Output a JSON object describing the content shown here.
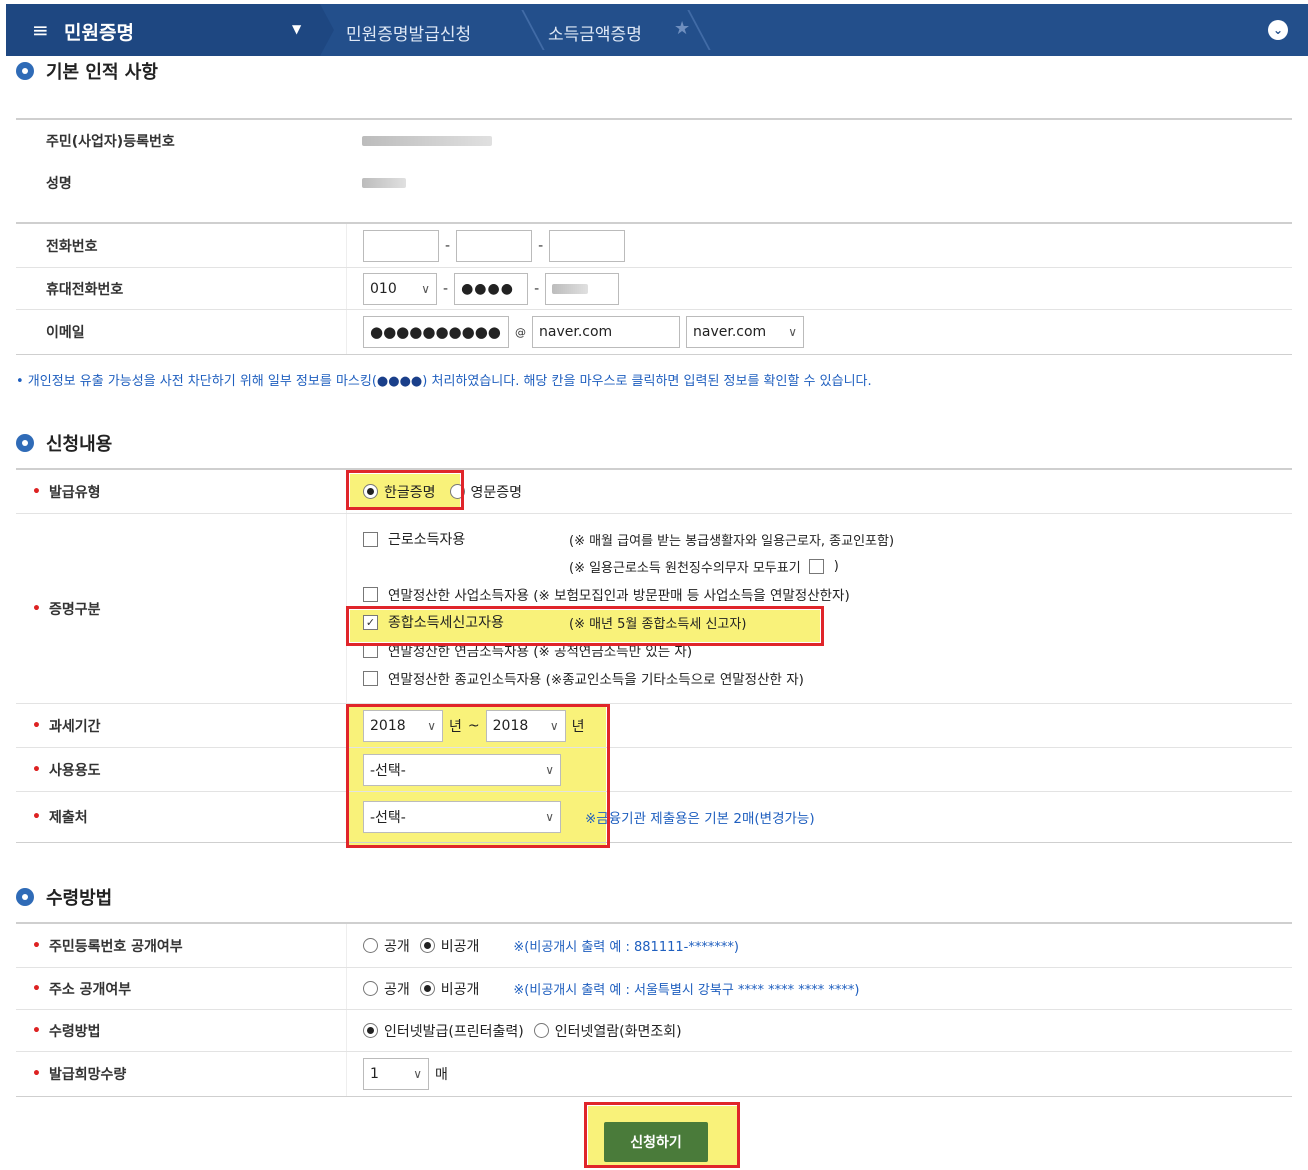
{
  "nav": {
    "menu_label": "민원증명",
    "breadcrumb1": "민원증명발급신청",
    "breadcrumb2": "소득금액증명"
  },
  "basic": {
    "title": "기본 인적 사항",
    "rrn_label": "주민(사업자)등록번호",
    "name_label": "성명",
    "phone_label": "전화번호",
    "mobile_label": "휴대전화번호",
    "mobile_prefix": "010",
    "mobile_mid": "●●●●",
    "email_label": "이메일",
    "email_id": "●●●●●●●●●●",
    "email_at": "@",
    "email_domain": "naver.com",
    "email_select": "naver.com"
  },
  "privacy_note": {
    "before": "• 개인정보 유출 가능성을 사전 차단하기 위해 일부 정보를 마스킹(",
    "dots": "●●●●",
    "after": ") 처리하였습니다. 해당 칸을 마우스로 클릭하면 입력된 정보를 확인할 수 있습니다."
  },
  "application": {
    "title": "신청내용",
    "type_label": "발급유형",
    "type_korean": "한글증명",
    "type_english": "영문증명",
    "category_label": "증명구분",
    "opt1": "근로소득자용",
    "opt1_note": "(※ 매월 급여를 받는 봉급생활자와 일용근로자, 종교인포함)",
    "opt1_note2": "(※ 일용근로소득 원천징수의무자 모두표기",
    "opt1_note2_end": ")",
    "opt2": "연말정산한 사업소득자용 (※ 보험모집인과 방문판매 등 사업소득을 연말정산한자)",
    "opt3": "종합소득세신고자용",
    "opt3_note": "(※ 매년 5월 종합소득세 신고자)",
    "opt4": "연말정산한 연금소득자용 (※ 공적연금소득만 있는 자)",
    "opt5": "연말정산한 종교인소득자용 (※종교인소득을 기타소득으로 연말정산한 자)",
    "period_label": "과세기간",
    "year_from": "2018",
    "year_unit": "년",
    "tilde": "~",
    "year_to": "2018",
    "use_label": "사용용도",
    "use_value": "-선택-",
    "submit_to_label": "제출처",
    "submit_to_value": "-선택-",
    "submit_to_note": "※금융기관 제출용은 기본 2매(변경가능)"
  },
  "receive": {
    "title": "수령방법",
    "rrn_open_label": "주민등록번호 공개여부",
    "open": "공개",
    "closed": "비공개",
    "rrn_note": "※(비공개시 출력 예 : 881111-*******)",
    "addr_open_label": "주소 공개여부",
    "addr_note": "※(비공개시 출력 예 : 서울특별시 강북구 **** **** **** ****)",
    "method_label": "수령방법",
    "method_internet_print": "인터넷발급(프린터출력)",
    "method_internet_view": "인터넷열람(화면조회)",
    "qty_label": "발급희망수량",
    "qty_value": "1",
    "qty_unit": "매"
  },
  "submit_label": "신청하기"
}
